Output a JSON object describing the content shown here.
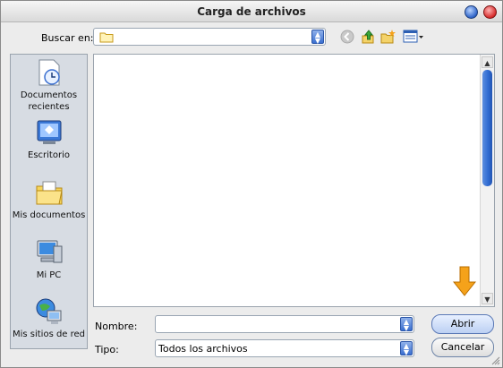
{
  "window": {
    "title": "Carga de archivos"
  },
  "toolbar": {
    "look_in_label": "Buscar en:",
    "look_in_value": "",
    "icons": [
      "back-icon",
      "up-folder-icon",
      "new-folder-icon",
      "views-menu-icon"
    ]
  },
  "places": [
    {
      "name": "recent",
      "label": "Documentos recientes",
      "icon": "recent-documents-icon"
    },
    {
      "name": "desktop",
      "label": "Escritorio",
      "icon": "desktop-icon"
    },
    {
      "name": "my-documents",
      "label": "Mis documentos",
      "icon": "my-documents-icon"
    },
    {
      "name": "my-pc",
      "label": "Mi PC",
      "icon": "my-computer-icon"
    },
    {
      "name": "network",
      "label": "Mis sitios de red",
      "icon": "network-places-icon"
    }
  ],
  "form": {
    "name_label": "Nombre:",
    "name_value": "",
    "type_label": "Tipo:",
    "type_value": "Todos los archivos"
  },
  "buttons": {
    "open": "Abrir",
    "cancel": "Cancelar"
  },
  "colors": {
    "accent": "#2f6ad1",
    "places_bg": "#d7dce3",
    "arrow": "#f5a21a"
  }
}
